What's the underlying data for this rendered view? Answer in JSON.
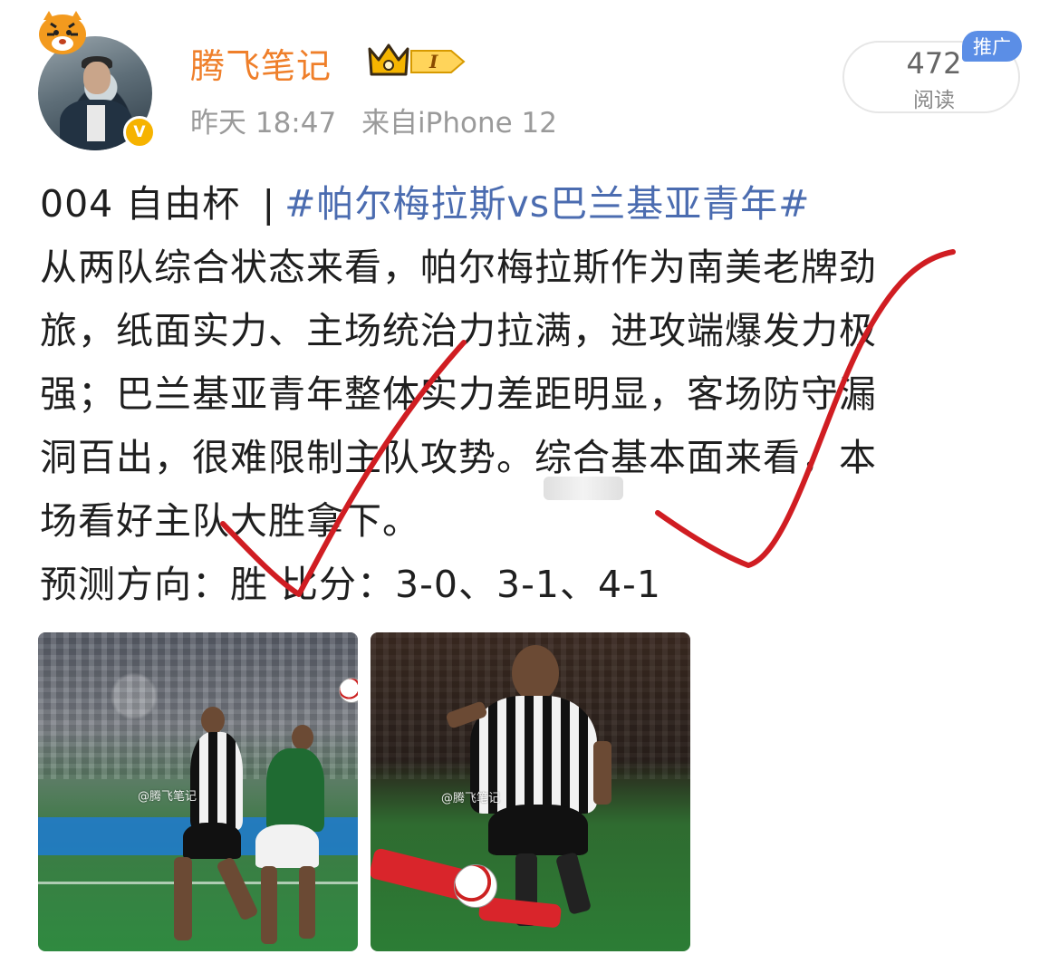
{
  "author": {
    "name": "腾飞笔记",
    "verified_mark": "V",
    "level_badge": "I",
    "icons": [
      "tiger-sticker-icon",
      "crown-icon",
      "verified-icon"
    ]
  },
  "meta": {
    "time": "昨天 18:47",
    "source": "来自iPhone 12"
  },
  "stats": {
    "read_count": "472",
    "read_label": "阅读",
    "promo_tag": "推广"
  },
  "post": {
    "prefix": "004 自由杯",
    "separator": "|",
    "hashtag": "#帕尔梅拉斯vs巴兰基亚青年#",
    "lines": [
      "从两队综合状态来看，帕尔梅拉斯作为南美老牌劲",
      "旅，纸面实力、主场统治力拉满，进攻端爆发力极",
      "强；巴兰基亚青年整体实力差距明显，客场防守漏",
      "洞百出，很难限制主队攻势。综合基本面来看，本",
      "场看好主队大胜拿下。",
      "预测方向：胜 比分：3-0、3-1、4-1"
    ]
  },
  "images": [
    {
      "watermark": "@腾飞笔记"
    },
    {
      "watermark": "@腾飞笔记"
    }
  ],
  "colors": {
    "username": "#ef7f2a",
    "hashtag": "#4b6cb0",
    "check_mark": "#d01d22",
    "promo": "#5b8ee6"
  }
}
